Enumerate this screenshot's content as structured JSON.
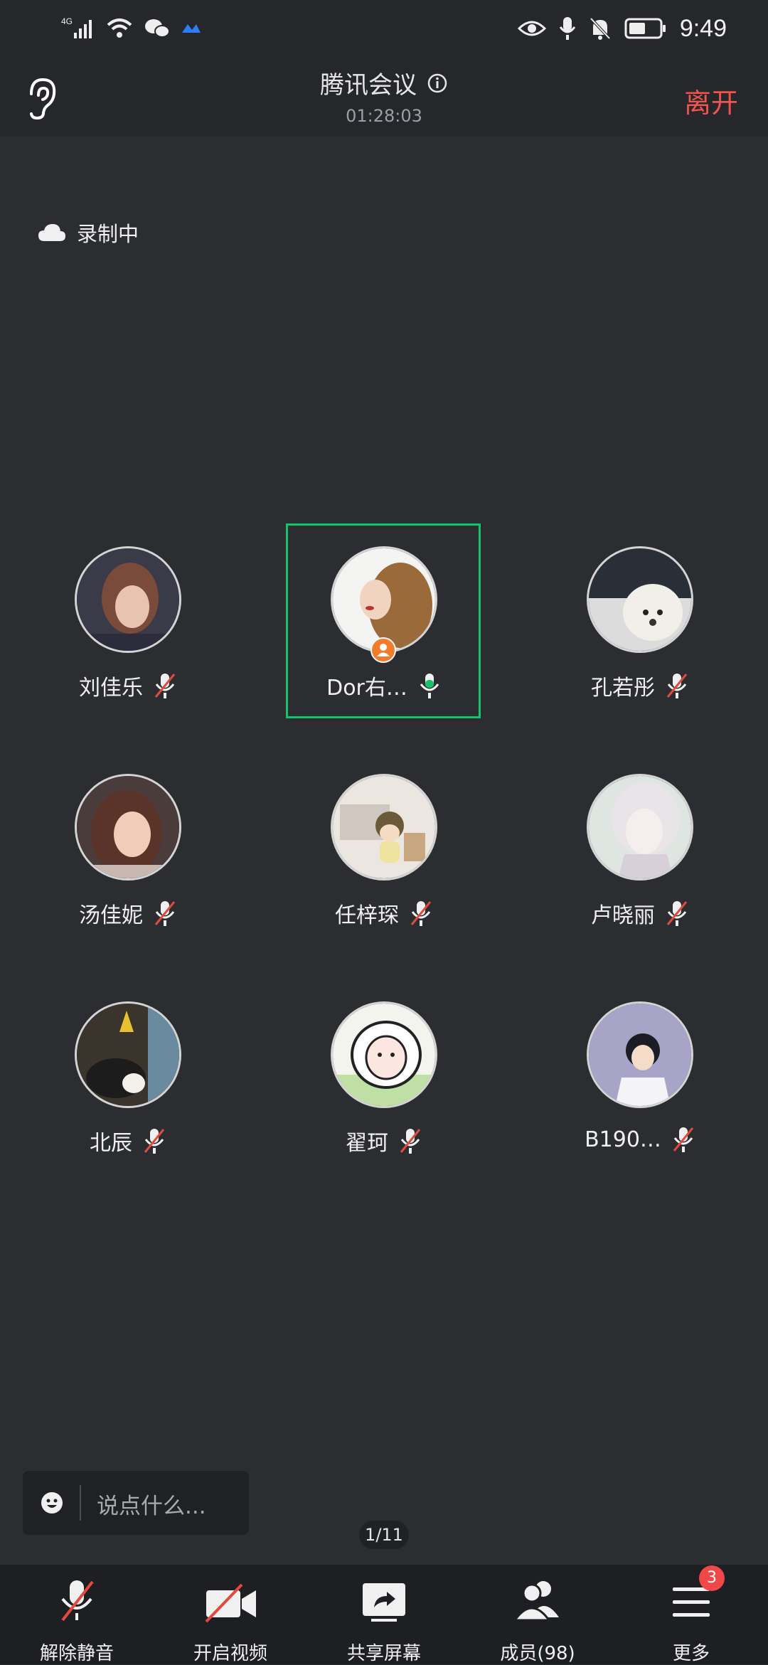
{
  "status_bar": {
    "network": "4G",
    "time": "9:49"
  },
  "nav": {
    "title": "腾讯会议",
    "timer": "01:28:03",
    "leave_label": "离开"
  },
  "recording": {
    "label": "录制中"
  },
  "participants": [
    {
      "name": "刘佳乐",
      "mic": "muted"
    },
    {
      "name": "Dor右…",
      "mic": "active",
      "host": true,
      "speaking": true
    },
    {
      "name": "孔若彤",
      "mic": "muted"
    },
    {
      "name": "汤佳妮",
      "mic": "muted"
    },
    {
      "name": "任梓琛",
      "mic": "muted"
    },
    {
      "name": "卢晓丽",
      "mic": "muted"
    },
    {
      "name": "北辰",
      "mic": "muted"
    },
    {
      "name": "翟珂",
      "mic": "muted"
    },
    {
      "name": "B190…",
      "mic": "muted"
    }
  ],
  "chat": {
    "placeholder": "说点什么..."
  },
  "page_indicator": "1/11",
  "toolbar": {
    "unmute_label": "解除静音",
    "video_label": "开启视频",
    "share_label": "共享屏幕",
    "members_label": "成员(98)",
    "more_label": "更多",
    "more_badge": "3"
  },
  "colors": {
    "accent_green": "#19c26a",
    "leave_red": "#f0544f",
    "mute_red": "#e04a3f",
    "badge_red": "#f04848",
    "host_orange": "#f07c2c"
  }
}
